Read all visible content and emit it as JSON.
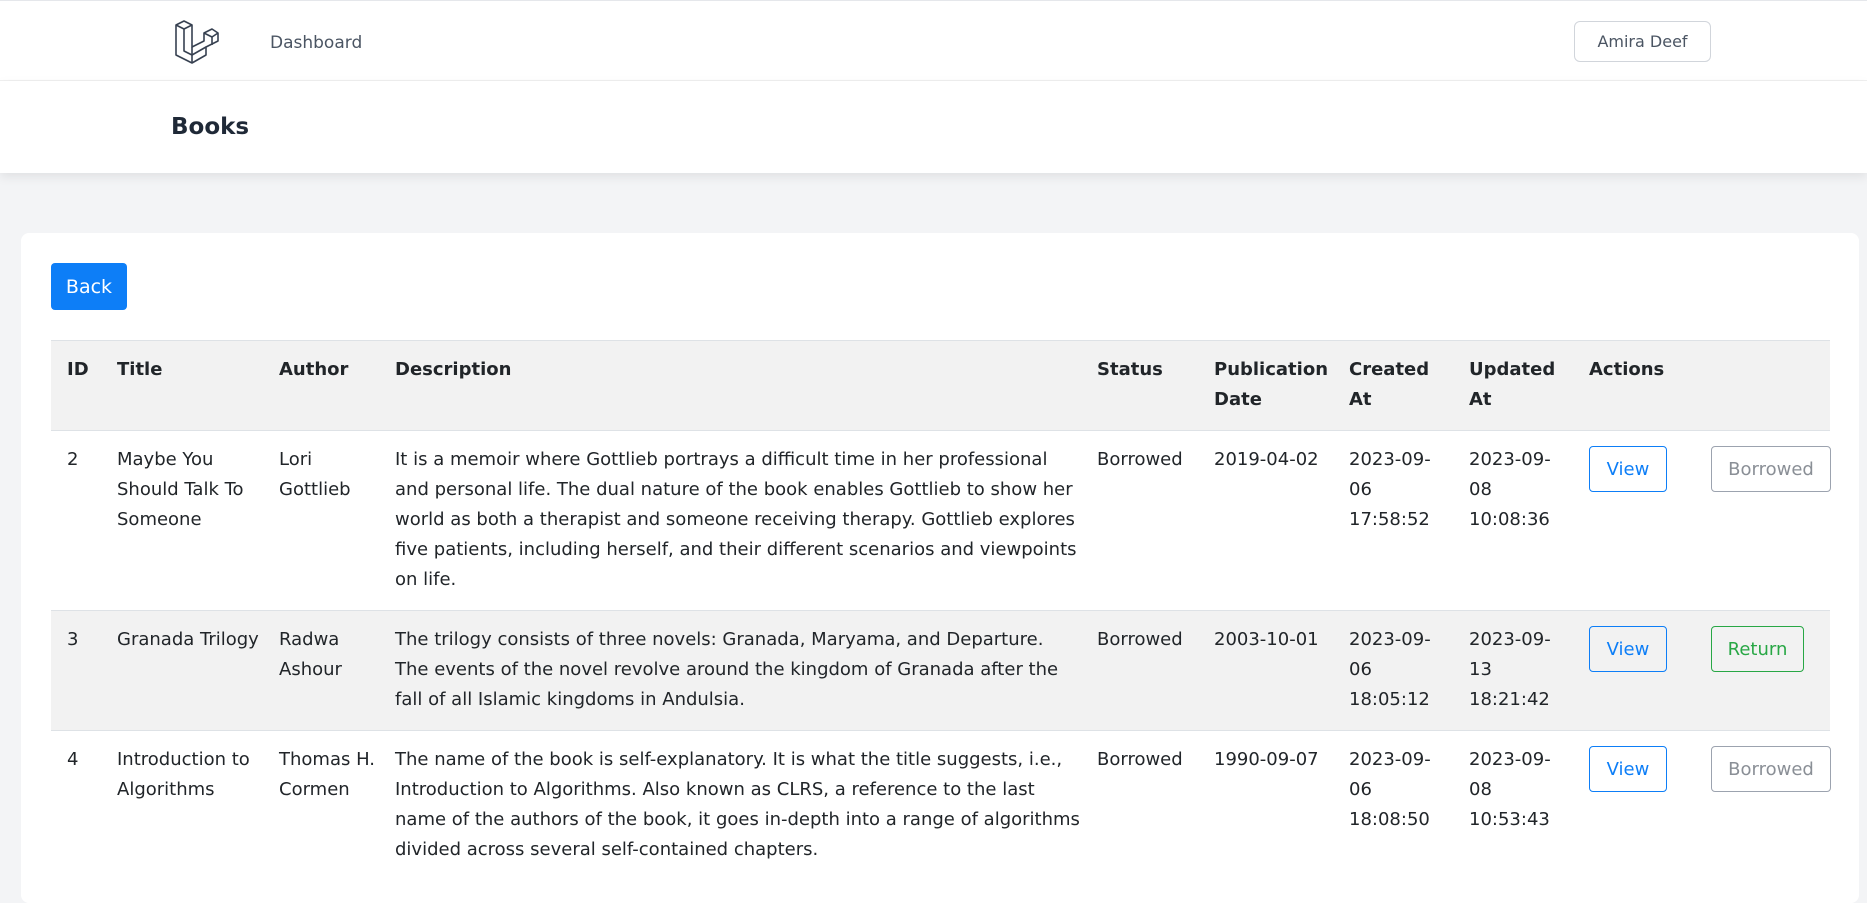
{
  "nav": {
    "logo_icon": "laravel-logo-icon",
    "dashboard_link": "Dashboard",
    "user_name": "Amira Deef"
  },
  "header": {
    "title": "Books"
  },
  "main": {
    "back_label": "Back",
    "table": {
      "columns": [
        "ID",
        "Title",
        "Author",
        "Description",
        "Status",
        "Publication Date",
        "Created At",
        "Updated At",
        "Actions"
      ],
      "rows": [
        {
          "id": "2",
          "title": "Maybe You Should Talk To Someone",
          "author": "Lori Gottlieb",
          "description": "It is a memoir where Gottlieb portrays a difficult time in her professional and personal life. The dual nature of the book enables Gottlieb to show her world as both a therapist and someone receiving therapy. Gottlieb explores five patients, including herself, and their different scenarios and viewpoints on life.",
          "status": "Borrowed",
          "publication_date": "2019-04-02",
          "created_at": "2023-09-06 17:58:52",
          "updated_at": "2023-09-08 10:08:36",
          "view_label": "View",
          "action_label": "Borrowed"
        },
        {
          "id": "3",
          "title": "Granada Trilogy",
          "author": "Radwa Ashour",
          "description": "The trilogy consists of three novels: Granada, Maryama, and Departure. The events of the novel revolve around the kingdom of Granada after the fall of all Islamic kingdoms in Andulsia.",
          "status": "Borrowed",
          "publication_date": "2003-10-01",
          "created_at": "2023-09-06 18:05:12",
          "updated_at": "2023-09-13 18:21:42",
          "view_label": "View",
          "action_label": "Return"
        },
        {
          "id": "4",
          "title": "Introduction to Algorithms",
          "author": "Thomas H. Cormen",
          "description": "The name of the book is self-explanatory. It is what the title suggests, i.e., Introduction to Algorithms. Also known as CLRS, a reference to the last name of the authors of the book, it goes in-depth into a range of algorithms divided across several self-contained chapters.",
          "status": "Borrowed",
          "publication_date": "1990-09-07",
          "created_at": "2023-09-06 18:08:50",
          "updated_at": "2023-09-08 10:53:43",
          "view_label": "View",
          "action_label": "Borrowed"
        }
      ]
    }
  },
  "colors": {
    "primary": "#0d7ef7",
    "success": "#28a745",
    "muted": "#8a8f96",
    "page_bg": "#f3f4f6",
    "stripe": "#f2f2f2"
  }
}
